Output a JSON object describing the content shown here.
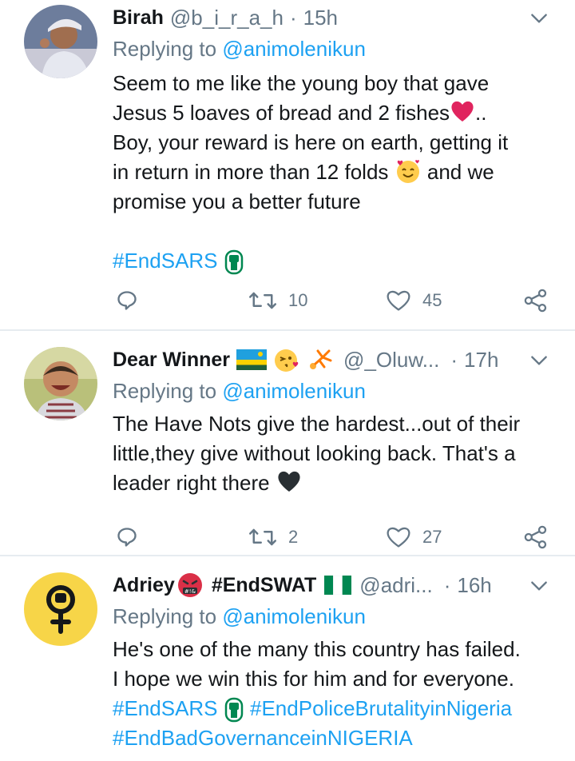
{
  "tweets": [
    {
      "display_name": "Birah",
      "handle": "@b_i_r_a_h",
      "separator": "·",
      "time": "15h",
      "replying_prefix": "Replying to ",
      "replying_to": "@animolenikun",
      "body_lines": [
        "Seem to me like the young boy that gave",
        "Jesus 5 loaves of bread and 2 fishes",
        "..",
        "Boy, your reward is here on earth, getting it",
        "in return in more than 12 folds",
        "and we",
        "promise you a better future"
      ],
      "hashtags": [
        "#EndSARS"
      ],
      "actions": {
        "retweets": "10",
        "likes": "45"
      }
    },
    {
      "display_name": "Dear Winner",
      "handle": "@_Oluw...",
      "separator": "·",
      "time": "17h",
      "replying_prefix": "Replying to ",
      "replying_to": "@animolenikun",
      "body_lines": [
        "The Have Nots give the hardest...out of their",
        "little,they give without looking back. That's a",
        "leader right there"
      ],
      "actions": {
        "retweets": "2",
        "likes": "27"
      }
    },
    {
      "display_name": "Adriey",
      "display_name_suffix": "#EndSWAT",
      "handle": "@adri...",
      "separator": "·",
      "time": "16h",
      "replying_prefix": "Replying to ",
      "replying_to": "@animolenikun",
      "body_lines": [
        "He's one of the many this country has failed.",
        "I hope we win this for him and for everyone."
      ],
      "hashtags": [
        "#EndSARS",
        "#EndPoliceBrutalityinNigeria",
        "#EndBadGovernanceinNIGERIA"
      ]
    }
  ],
  "colors": {
    "link": "#1da1f2",
    "secondary_text": "#657786",
    "divider": "#e6ecf0",
    "heart_red": "#e0245e",
    "nigeria_green": "#008751"
  }
}
